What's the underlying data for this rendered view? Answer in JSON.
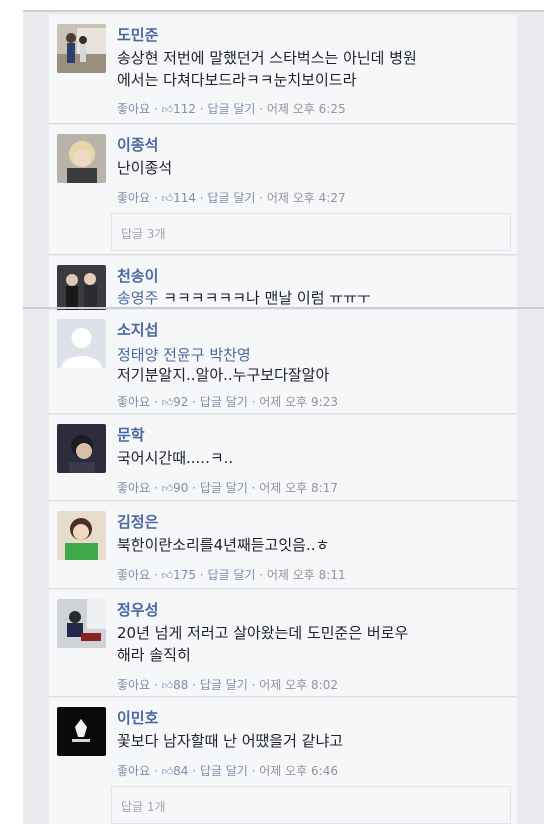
{
  "comments": [
    {
      "name": "도민준",
      "lines": [
        "송상현 저번에 말했던거 스타벅스는 아닌데 병원",
        "에서는 다쳐다보드라ㅋㅋ눈치보이드라"
      ],
      "like": "좋아요",
      "count": "112",
      "reply": "답글 달기",
      "time": "어제 오후 6:25",
      "avatar": "photo-two-people-outdoor"
    },
    {
      "name": "이종석",
      "lines": [
        "난이종석"
      ],
      "like": "좋아요",
      "count": "114",
      "reply": "답글 달기",
      "time": "어제 오후 4:27",
      "replies": "답글 3개",
      "avatar": "photo-blond-man"
    },
    {
      "name": "천송이",
      "tags": "송영주",
      "lines": [
        "ㅋㅋㅋㅋㅋㅋ나 맨날 이럼 ㅠㅠㅜ"
      ],
      "avatar": "photo-couple-formal"
    },
    {
      "name": "소지섭",
      "tags": "정태양 전윤구 박찬영",
      "lines": [
        "저기분알지..알아..누구보다잘알아"
      ],
      "like": "좋아요",
      "count": "92",
      "reply": "답글 달기",
      "time": "어제 오후 9:23",
      "avatar": "default-silhouette"
    },
    {
      "name": "문학",
      "lines": [
        "국어시간때.....ㅋ.."
      ],
      "like": "좋아요",
      "count": "90",
      "reply": "답글 달기",
      "time": "어제 오후 8:17",
      "avatar": "photo-dark-haired-man"
    },
    {
      "name": "김정은",
      "lines": [
        "북한이란소리를4년째듣고잇음..ㅎ"
      ],
      "like": "좋아요",
      "count": "175",
      "reply": "답글 달기",
      "time": "어제 오후 8:11",
      "avatar": "photo-man-green-shirt"
    },
    {
      "name": "정우성",
      "lines": [
        "20년 넘게 저러고 살아왔는데 도민준은 버로우",
        "해라 솔직히"
      ],
      "like": "좋아요",
      "count": "88",
      "reply": "답글 달기",
      "time": "어제 오후 8:02",
      "avatar": "photo-man-sitting"
    },
    {
      "name": "이민호",
      "lines": [
        "꽃보다 남자할때 난 어땠을거 같냐고"
      ],
      "like": "좋아요",
      "count": "84",
      "reply": "답글 달기",
      "time": "어제 오후 6:46",
      "replies": "답글 1개",
      "avatar": "photo-dark-logo"
    }
  ],
  "colors": {
    "name": "#4b67a1",
    "meta": "#90949c",
    "card": "#f6f7f9",
    "page": "#e9ebee"
  }
}
